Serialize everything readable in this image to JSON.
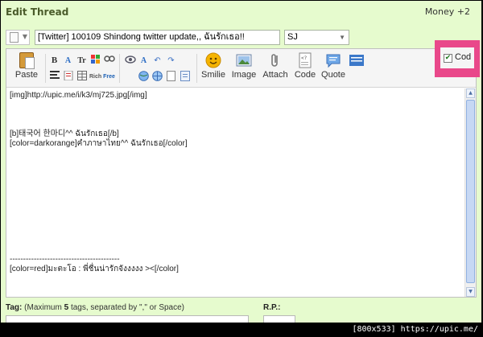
{
  "header": {
    "title": "Edit Thread",
    "money": "Money +2"
  },
  "form": {
    "subject_value": "[Twitter] 100109 Shindong twitter update,, ฉันรักเธอ!!",
    "forum_select": "SJ"
  },
  "toolbar": {
    "paste_label": "Paste",
    "smilie_label": "Smilie",
    "image_label": "Image",
    "attach_label": "Attach",
    "code_label": "Code",
    "quote_label": "Quote",
    "rich_label": "Rich",
    "free_label": "Free",
    "tt_label": "Tr"
  },
  "code_toggle": {
    "label": "Cod",
    "checked": true
  },
  "editor": {
    "lines": [
      "[img]http://upic.me/i/k3/mj725.jpg[/img]",
      "",
      "",
      "",
      "[b]태국어 한마디^^ ฉันรักเธอ[/b]",
      "[color=darkorange]คำภาษาไทย^^ ฉันรักเธอ[/color]",
      "",
      "",
      "",
      "",
      "",
      "",
      "",
      "",
      "",
      "",
      "",
      "-----------------------------------------",
      "[color=red]มะตะโอ : พี่ชื่นน่ารักจังงงงง ><[/color]"
    ]
  },
  "footer_form": {
    "tag_label": "Tag:",
    "tag_hint_pre": "(Maximum ",
    "tag_hint_num": "5",
    "tag_hint_post": " tags, separated by \",\" or Space)",
    "rp_label": "R.P.:"
  },
  "watermark": "[800x533] https://upic.me/",
  "colors": {
    "background": "#e6fbce",
    "highlight": "#e9488a",
    "scroll_thumb": "#c6d8f4"
  }
}
